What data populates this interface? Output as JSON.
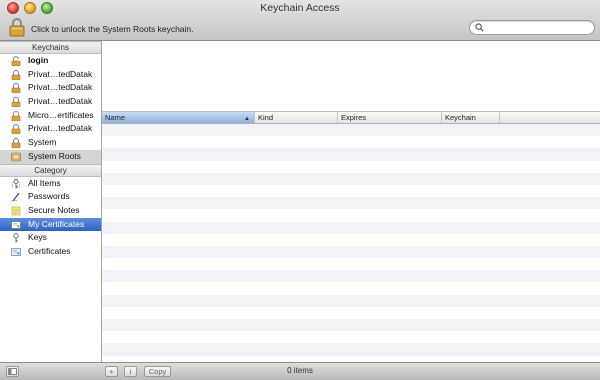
{
  "window": {
    "title": "Keychain Access"
  },
  "toolbar": {
    "lock_message": "Click to unlock the System Roots keychain.",
    "search_placeholder": ""
  },
  "sidebar": {
    "keychains_header": "Keychains",
    "keychains": [
      {
        "label": "login",
        "icon": "lock-open-icon"
      },
      {
        "label": "Privat…tedDatak",
        "icon": "lock-icon"
      },
      {
        "label": "Privat…tedDatak",
        "icon": "lock-icon"
      },
      {
        "label": "Privat…tedDatak",
        "icon": "lock-icon"
      },
      {
        "label": "Micro…ertificates",
        "icon": "lock-icon"
      },
      {
        "label": "Privat…tedDatak",
        "icon": "lock-icon"
      },
      {
        "label": "System",
        "icon": "lock-icon"
      },
      {
        "label": "System Roots",
        "icon": "cabinet-icon"
      }
    ],
    "category_header": "Category",
    "categories": [
      {
        "label": "All Items",
        "icon": "all-items-icon"
      },
      {
        "label": "Passwords",
        "icon": "pen-icon"
      },
      {
        "label": "Secure Notes",
        "icon": "note-icon"
      },
      {
        "label": "My Certificates",
        "icon": "my-certificate-icon"
      },
      {
        "label": "Keys",
        "icon": "key-icon"
      },
      {
        "label": "Certificates",
        "icon": "certificate-icon"
      }
    ]
  },
  "table": {
    "columns": [
      "Name",
      "Kind",
      "Expires",
      "Keychain"
    ],
    "sorted_column": "Name"
  },
  "bottombar": {
    "add_label": "+",
    "info_label": "i",
    "copy_label": "Copy",
    "status": "0 items"
  },
  "colors": {
    "selection": "#3366cc",
    "stripe": "#f0f3f8",
    "close": "#e0463c",
    "minimize": "#e8a92a",
    "zoom": "#5cb53d"
  }
}
